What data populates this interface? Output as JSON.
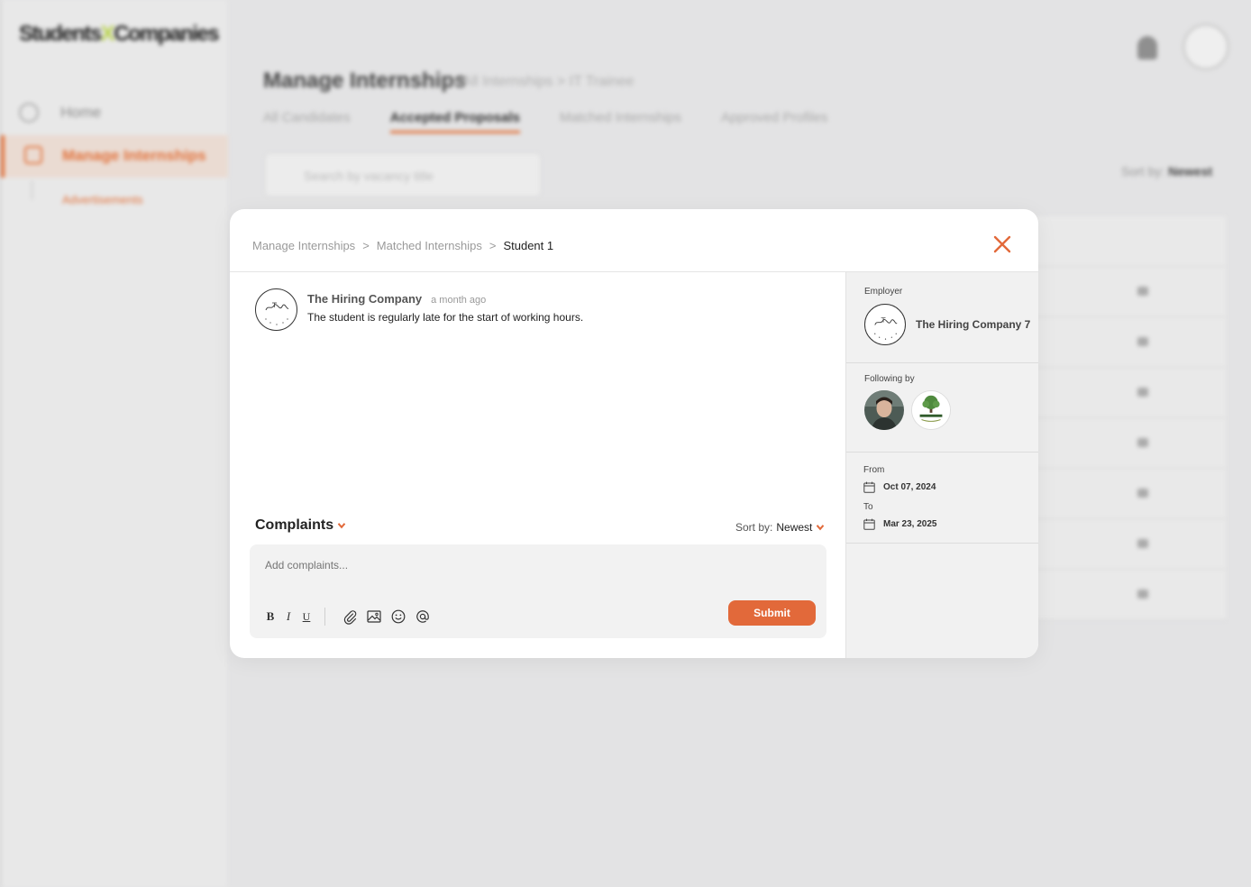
{
  "background": {
    "logo": {
      "part1": "Students",
      "sep": "X",
      "part2": "Companies"
    },
    "sidebar": {
      "home": "Home",
      "manage_internships": "Manage Internships",
      "advertisements": "Advertisements"
    },
    "page_title": "Manage Internships",
    "breadcrumb": ">  All Internships  >  IT Trainee",
    "tabs": [
      "All Candidates",
      "Accepted Proposals",
      "Matched Internships",
      "Approved Profiles"
    ],
    "search_placeholder": "Search by vacancy title",
    "sort_label": "Sort by:",
    "sort_value": "Newest"
  },
  "modal": {
    "breadcrumb": [
      "Manage Internships",
      "Matched Internships",
      "Student 1"
    ],
    "breadcrumb_sep": ">",
    "comment": {
      "author": "The Hiring Company",
      "time": "a month ago",
      "text": "The student is regularly late for the start of working hours."
    },
    "complaints_title": "Complaints",
    "sort_label": "Sort by:",
    "sort_value": "Newest",
    "composer": {
      "placeholder": "Add complaints...",
      "bold": "B",
      "italic": "I",
      "underline": "U",
      "submit": "Submit"
    },
    "side": {
      "employer_label": "Employer",
      "employer_name": "The Hiring Company 7",
      "following_label": "Following by",
      "from_label": "From",
      "from_date": "Oct 07, 2024",
      "to_label": "To",
      "to_date": "Mar 23, 2025"
    }
  },
  "colors": {
    "accent": "#e2693a",
    "overlay": "#e3e3e4",
    "panel": "#f1f1f1"
  },
  "icons": [
    "bell-icon",
    "avatar",
    "close-icon",
    "chevron-down-icon",
    "attachment-icon",
    "image-icon",
    "emoji-icon",
    "mention-icon",
    "calendar-icon"
  ]
}
